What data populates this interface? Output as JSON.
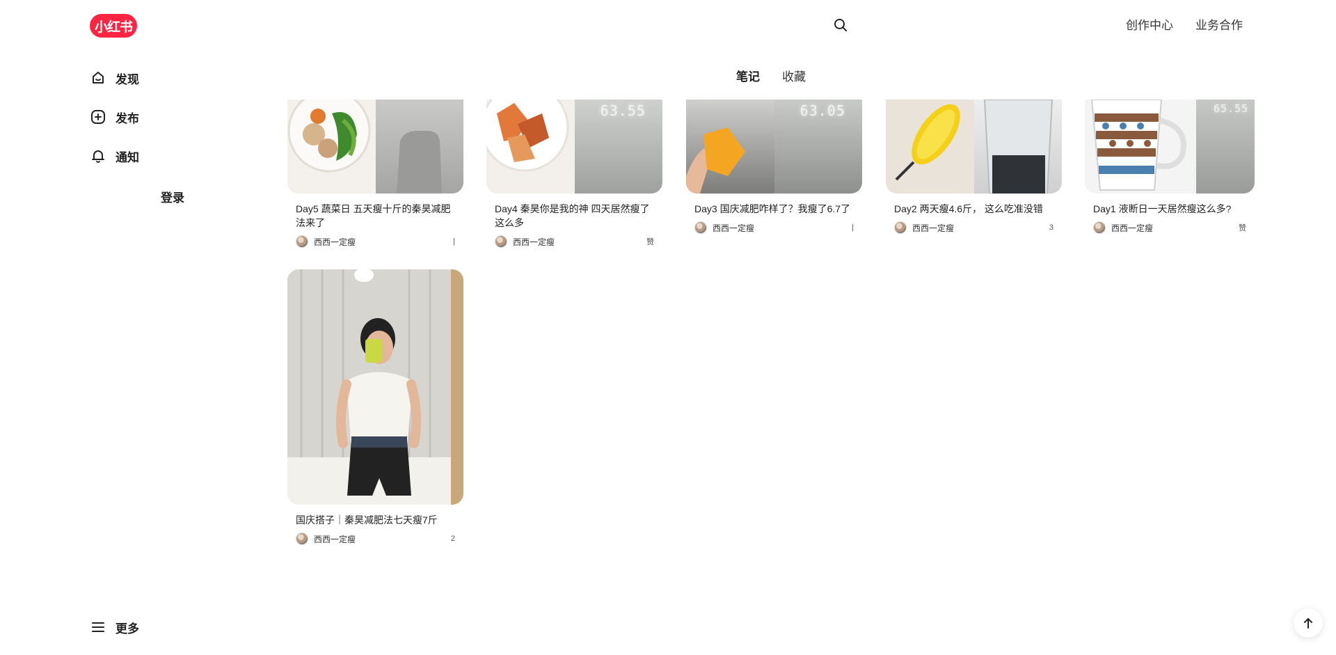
{
  "header": {
    "logo_text": "小红书",
    "links": [
      "创作中心",
      "业务合作"
    ]
  },
  "sidebar": {
    "items": [
      {
        "label": "发现",
        "icon": "home-icon"
      },
      {
        "label": "发布",
        "icon": "plus-square-icon"
      },
      {
        "label": "通知",
        "icon": "bell-icon"
      }
    ],
    "login_label": "登录",
    "more_label": "更多"
  },
  "tabs": [
    {
      "label": "笔记",
      "active": true
    },
    {
      "label": "收藏",
      "active": false
    }
  ],
  "notes": [
    {
      "title": "Day5 蔬菜日 五天瘦十斤的秦昊减肥法来了",
      "author": "西西一定瘦",
      "likes": "|"
    },
    {
      "title": "Day4 秦昊你是我的神 四天居然瘦了这么多",
      "author": "西西一定瘦",
      "likes": "赞",
      "scale": "63.55"
    },
    {
      "title": "Day3 国庆减肥咋样了？我瘦了6.7了",
      "author": "西西一定瘦",
      "likes": "|",
      "scale": "63.05"
    },
    {
      "title": "Day2 两天瘦4.6斤， 这么吃准没错",
      "author": "西西一定瘦",
      "likes": "3"
    },
    {
      "title": "Day1 液断日一天居然瘦这么多?",
      "author": "西西一定瘦",
      "likes": "赞",
      "scale": "65.55"
    },
    {
      "title": "国庆搭子｜秦昊减肥法七天瘦7斤",
      "author": "西西一定瘦",
      "likes": "2"
    }
  ],
  "colors": {
    "brand": "#ff2442",
    "text": "#222222"
  }
}
